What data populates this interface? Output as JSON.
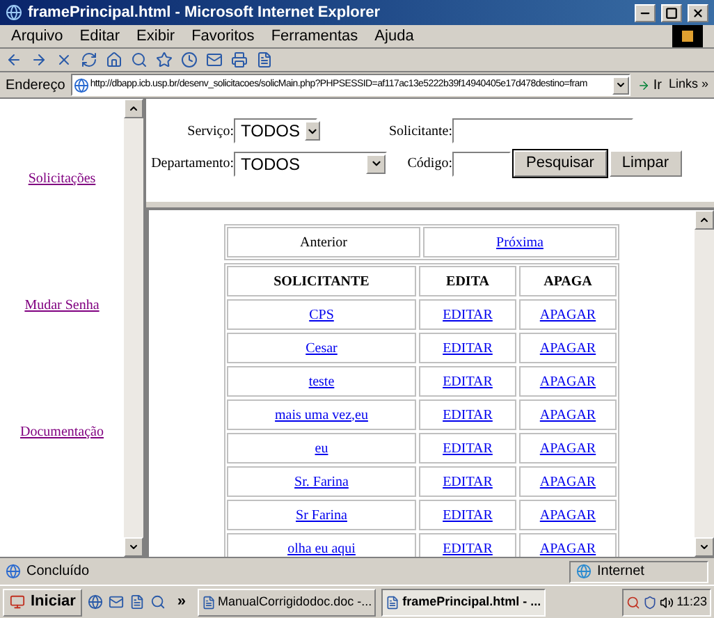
{
  "window": {
    "title": "framePrincipal.html - Microsoft Internet Explorer"
  },
  "menu": [
    "Arquivo",
    "Editar",
    "Exibir",
    "Favoritos",
    "Ferramentas",
    "Ajuda"
  ],
  "address": {
    "label": "Endereço",
    "url": "http://dbapp.icb.usp.br/desenv_solicitacoes/solicMain.php?PHPSESSID=af117ac13e5222b39f14940405e17d478destino=fram",
    "go": "Ir",
    "links": "Links »"
  },
  "sidebar": {
    "links": [
      "Solicitações",
      "Mudar Senha",
      "Documentação"
    ]
  },
  "search": {
    "servico": {
      "label": "Serviço:",
      "value": "TODOS"
    },
    "departamento": {
      "label": "Departamento:",
      "value": "TODOS"
    },
    "solicitante": {
      "label": "Solicitante:"
    },
    "codigo": {
      "label": "Código:"
    },
    "buttons": [
      "Pesquisar",
      "Limpar"
    ]
  },
  "pagination": {
    "previous": {
      "label": "Anterior",
      "disabled": true
    },
    "next": {
      "label": "Próxima",
      "disabled": false
    }
  },
  "table": {
    "columns": [
      "SOLICITANTE",
      "EDITA",
      "APAGA"
    ],
    "rows": [
      {
        "solicitante": "CPS",
        "edita": "EDITAR",
        "apaga": "APAGAR"
      },
      {
        "solicitante": "Cesar",
        "edita": "EDITAR",
        "apaga": "APAGAR"
      },
      {
        "solicitante": "teste",
        "edita": "EDITAR",
        "apaga": "APAGAR"
      },
      {
        "solicitante": "mais uma vez,eu",
        "edita": "EDITAR",
        "apaga": "APAGAR"
      },
      {
        "solicitante": "eu",
        "edita": "EDITAR",
        "apaga": "APAGAR"
      },
      {
        "solicitante": "Sr. Farina",
        "edita": "EDITAR",
        "apaga": "APAGAR"
      },
      {
        "solicitante": "Sr Farina",
        "edita": "EDITAR",
        "apaga": "APAGAR"
      },
      {
        "solicitante": "olha eu aqui",
        "edita": "EDITAR",
        "apaga": "APAGAR"
      }
    ]
  },
  "status_bar": {
    "text": "Concluído",
    "zone": "Internet"
  },
  "taskbar": {
    "start": "Iniciar",
    "more": "»",
    "tasks": [
      {
        "label": "ManualCorrigidodoc.doc -...",
        "selected": false
      },
      {
        "label": "framePrincipal.html - ...",
        "selected": true
      }
    ],
    "clock": "11:23"
  }
}
